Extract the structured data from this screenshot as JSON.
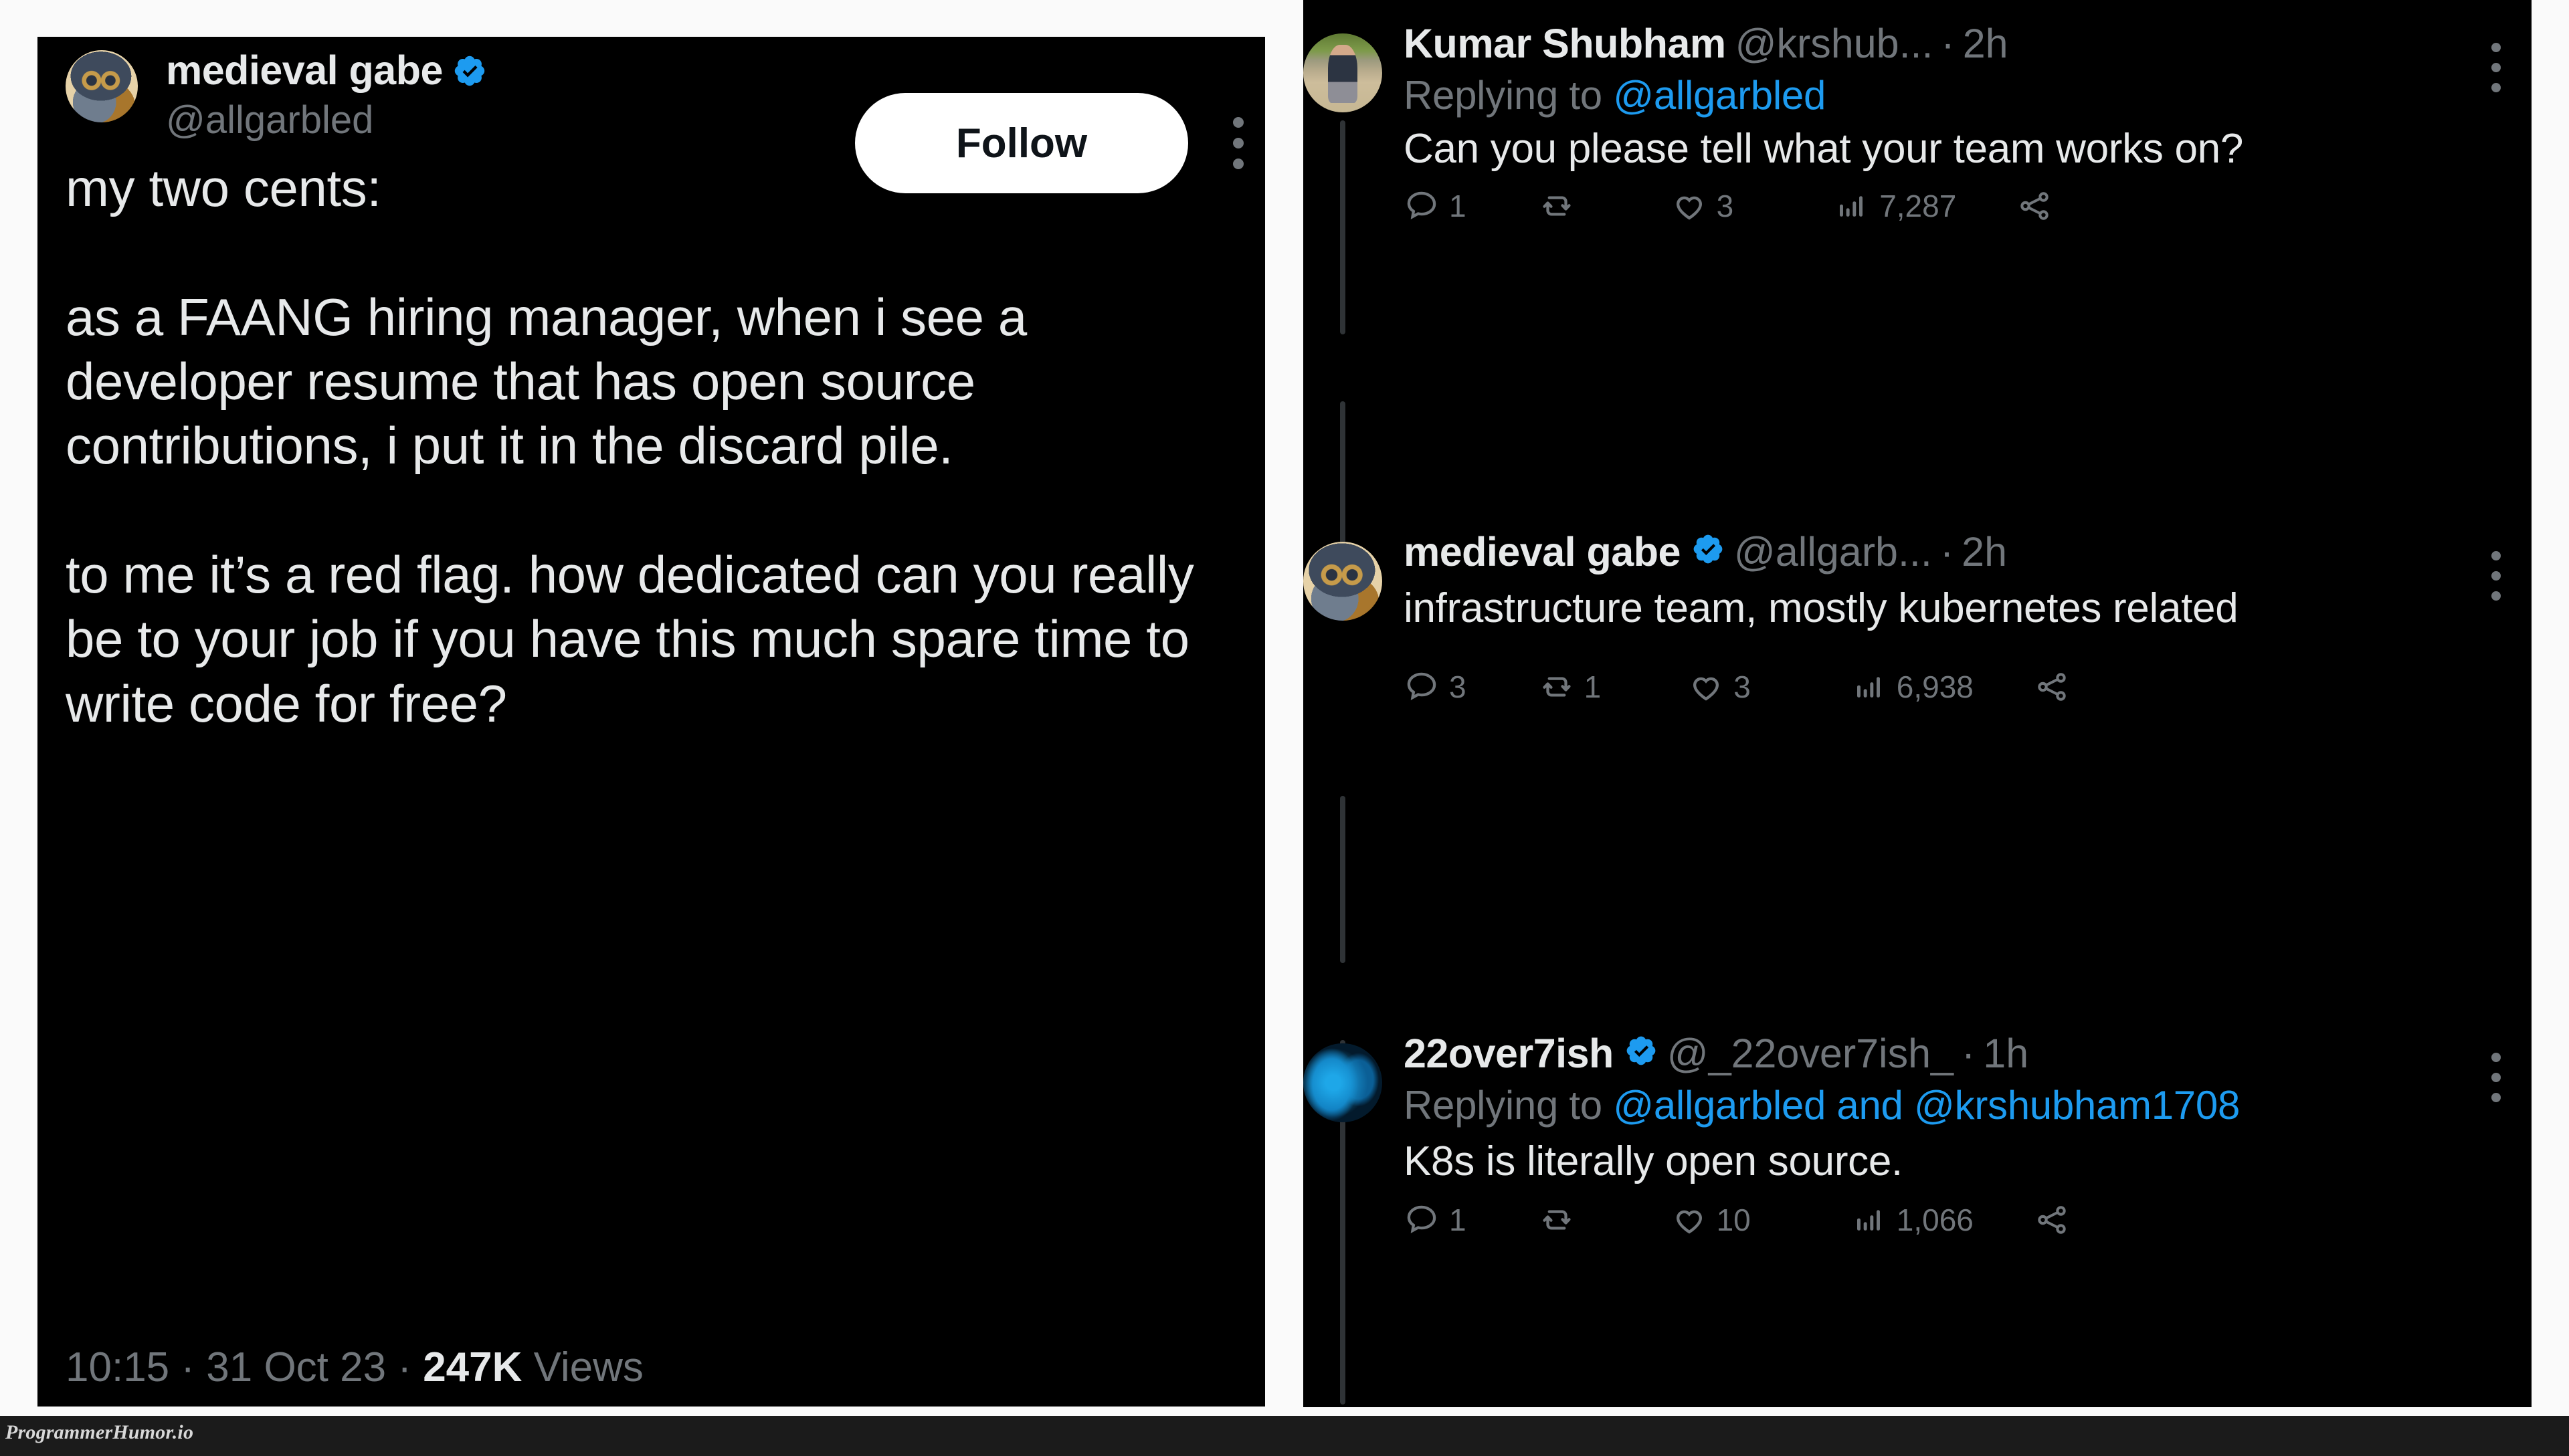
{
  "main_tweet": {
    "display_name": "medieval gabe",
    "handle": "@allgarbled",
    "verified": true,
    "follow_label": "Follow",
    "body": "my two cents:\n\nas a FAANG hiring manager, when i see a developer resume that has open source contributions, i put it in the discard pile.\n\nto me it’s a red flag. how dedicated can you really be to your job if you have this much spare time to write code for free?",
    "time": "10:15",
    "date": "31 Oct 23",
    "views_count": "247K",
    "views_label": "Views",
    "separator": " · "
  },
  "replies": [
    {
      "display_name": "Kumar Shubham",
      "handle": "@krshub...",
      "verified": false,
      "time": "2h",
      "replying_prefix": "Replying to ",
      "replying_to": [
        "@allgarbled"
      ],
      "text": "Can you please tell what your team works on?",
      "avatar": "photo-avatar",
      "actions": {
        "reply_count": "1",
        "retweet_count": "",
        "like_count": "3",
        "views_count": "7,287"
      }
    },
    {
      "display_name": "medieval gabe",
      "handle": "@allgarb...",
      "verified": true,
      "time": "2h",
      "replying_prefix": "",
      "replying_to": [],
      "text": "infrastructure team, mostly kubernetes related",
      "avatar": "owl-avatar",
      "actions": {
        "reply_count": "3",
        "retweet_count": "1",
        "like_count": "3",
        "views_count": "6,938"
      }
    },
    {
      "display_name": "22over7ish",
      "handle": "@_22over7ish_",
      "verified": true,
      "time": "1h",
      "replying_prefix": "Replying to ",
      "replying_to": [
        "@allgarbled",
        "and",
        "@krshubham1708"
      ],
      "text": "K8s is literally open source.",
      "avatar": "brain-avatar",
      "actions": {
        "reply_count": "1",
        "retweet_count": "",
        "like_count": "10",
        "views_count": "1,066"
      }
    }
  ],
  "watermark": "ProgrammerHumor.io",
  "colors": {
    "background": "#000000",
    "page": "#fafafa",
    "text_primary": "#e7e9ea",
    "text_secondary": "#71767b",
    "link": "#1d9bf0",
    "verified_blue": "#1d9bf0",
    "thread_line": "#2f3336",
    "watermark_bar": "#1b1b1b"
  }
}
